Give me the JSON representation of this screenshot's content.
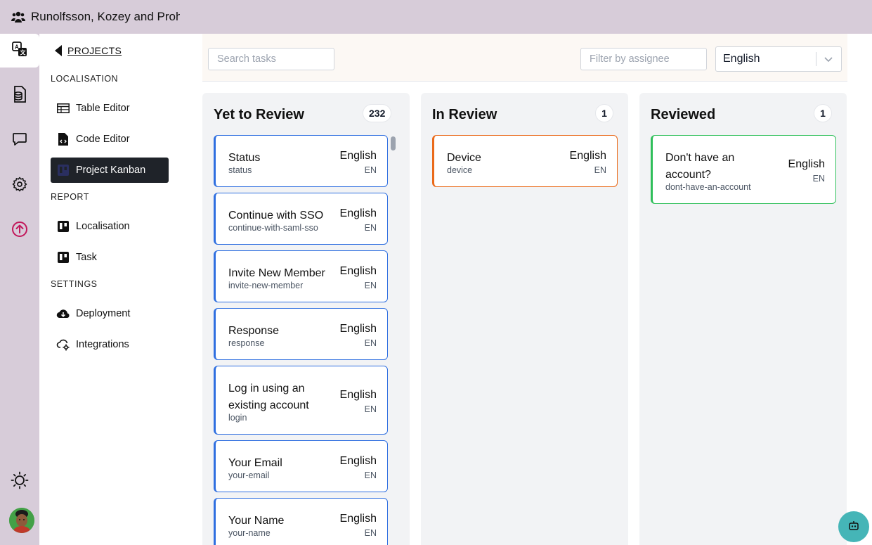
{
  "topbar": {
    "org_name": "Runolfsson, Kozey and Prohaska"
  },
  "rail": {
    "items": [
      {
        "name": "translate-icon",
        "active": true
      },
      {
        "name": "database-icon",
        "active": false
      },
      {
        "name": "chat-icon",
        "active": false
      },
      {
        "name": "gear-icon",
        "active": false
      },
      {
        "name": "upload-icon",
        "active": false
      }
    ],
    "theme_icon": "sun-icon",
    "accent_color": "#c2185b"
  },
  "sidebar": {
    "back_label": "PROJECTS",
    "sections": [
      {
        "label": "LOCALISATION",
        "items": [
          {
            "label": "Table Editor",
            "icon": "table-icon"
          },
          {
            "label": "Code Editor",
            "icon": "code-file-icon"
          },
          {
            "label": "Project Kanban",
            "icon": "kanban-icon",
            "active": true
          }
        ]
      },
      {
        "label": "REPORT",
        "items": [
          {
            "label": "Localisation",
            "icon": "report-icon"
          },
          {
            "label": "Task",
            "icon": "report-icon"
          }
        ]
      },
      {
        "label": "SETTINGS",
        "items": [
          {
            "label": "Deployment",
            "icon": "cloud-download-icon"
          },
          {
            "label": "Integrations",
            "icon": "cloud-gear-icon"
          }
        ]
      }
    ]
  },
  "toolbar": {
    "search_placeholder": "Search tasks",
    "assignee_placeholder": "Filter by assignee",
    "language_value": "English"
  },
  "columns": [
    {
      "title": "Yet to Review",
      "count": "232",
      "color": "#2f6fe0",
      "cards": [
        {
          "title": "Status",
          "key": "status",
          "lang": "English",
          "code": "EN"
        },
        {
          "title": "Continue with SSO",
          "key": "continue-with-saml-sso",
          "lang": "English",
          "code": "EN"
        },
        {
          "title": "Invite New Member",
          "key": "invite-new-member",
          "lang": "English",
          "code": "EN"
        },
        {
          "title": "Response",
          "key": "response",
          "lang": "English",
          "code": "EN"
        },
        {
          "title": "Log in using an existing account",
          "key": "login",
          "lang": "English",
          "code": "EN"
        },
        {
          "title": "Your Email",
          "key": "your-email",
          "lang": "English",
          "code": "EN"
        },
        {
          "title": "Your Name",
          "key": "your-name",
          "lang": "English",
          "code": "EN"
        }
      ]
    },
    {
      "title": "In Review",
      "count": "1",
      "color": "#ea6a1a",
      "cards": [
        {
          "title": "Device",
          "key": "device",
          "lang": "English",
          "code": "EN"
        }
      ]
    },
    {
      "title": "Reviewed",
      "count": "1",
      "color": "#2fbf5a",
      "cards": [
        {
          "title": "Don't have an account?",
          "key": "dont-have-an-account",
          "lang": "English",
          "code": "EN"
        }
      ]
    }
  ],
  "assistant": {
    "icon": "robot-icon",
    "color": "#45b5b7"
  }
}
